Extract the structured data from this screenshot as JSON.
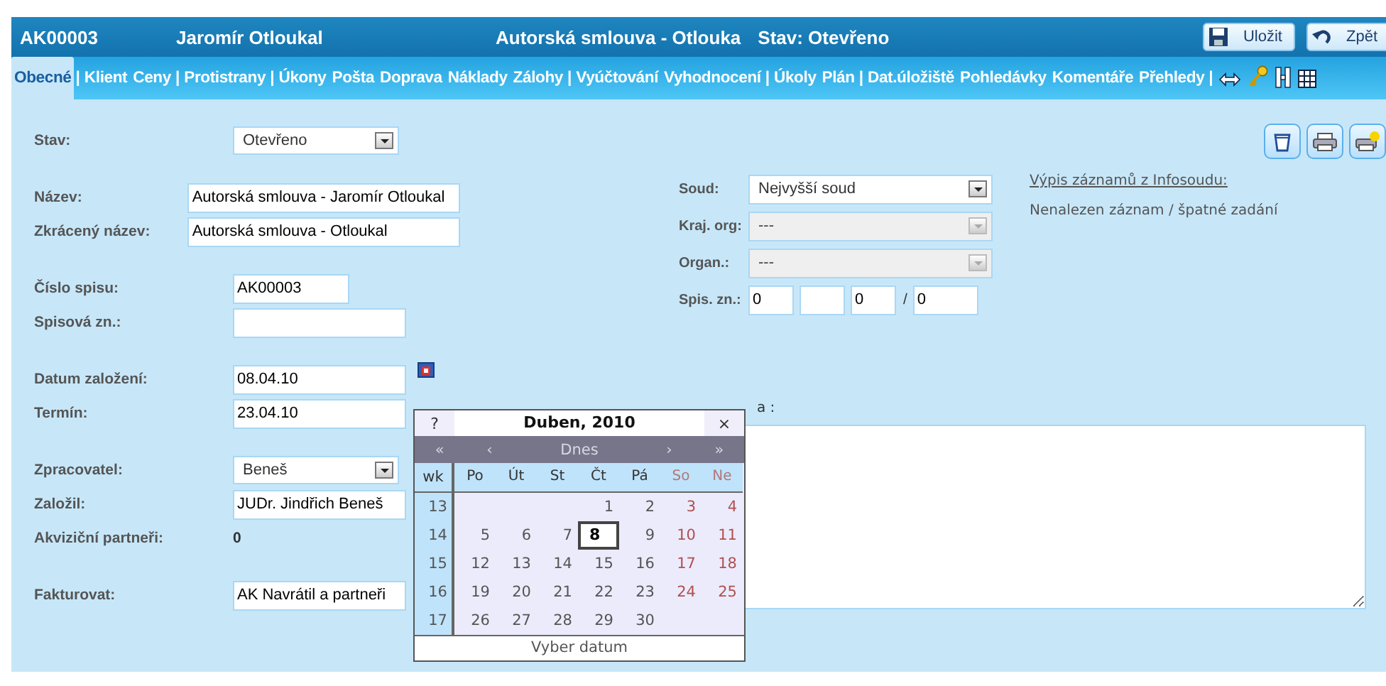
{
  "header": {
    "code": "AK00003",
    "client": "Jaromír Otloukal",
    "title": "Autorská smlouva - Otlouka",
    "status": "Stav:  Otevřeno",
    "buttons": [
      {
        "kind": "save",
        "label": "Uložit"
      },
      {
        "kind": "back",
        "label": "Zpět"
      }
    ]
  },
  "tabs": [
    {
      "kind": "tab",
      "label": "Obecné",
      "selected": true
    },
    {
      "kind": "sep",
      "label": "|"
    },
    {
      "kind": "tab",
      "label": "Klient",
      "selected": false
    },
    {
      "kind": "tab",
      "label": "Ceny",
      "selected": false
    },
    {
      "kind": "sep",
      "label": "|"
    },
    {
      "kind": "tab",
      "label": "Protistrany",
      "selected": false
    },
    {
      "kind": "sep",
      "label": "|"
    },
    {
      "kind": "tab",
      "label": "Úkony",
      "selected": false
    },
    {
      "kind": "tab",
      "label": "Pošta",
      "selected": false
    },
    {
      "kind": "tab",
      "label": "Doprava",
      "selected": false
    },
    {
      "kind": "tab",
      "label": "Náklady",
      "selected": false
    },
    {
      "kind": "tab",
      "label": "Zálohy",
      "selected": false
    },
    {
      "kind": "sep",
      "label": "|"
    },
    {
      "kind": "tab",
      "label": "Vyúčtování",
      "selected": false
    },
    {
      "kind": "tab",
      "label": "Vyhodnocení",
      "selected": false
    },
    {
      "kind": "sep",
      "label": "|"
    },
    {
      "kind": "tab",
      "label": "Úkoly",
      "selected": false
    },
    {
      "kind": "tab",
      "label": "Plán",
      "selected": false
    },
    {
      "kind": "sep",
      "label": "|"
    },
    {
      "kind": "tab",
      "label": "Dat.úložiště",
      "selected": false
    },
    {
      "kind": "tab",
      "label": "Pohledávky",
      "selected": false
    },
    {
      "kind": "tab",
      "label": "Komentáře",
      "selected": false
    },
    {
      "kind": "tab",
      "label": "Přehledy",
      "selected": false
    },
    {
      "kind": "sep",
      "label": "|"
    },
    {
      "kind": "icon"
    },
    {
      "kind": "icon"
    },
    {
      "kind": "icon"
    },
    {
      "kind": "icon"
    }
  ],
  "left_fields": [
    {
      "label": "Stav:",
      "kind": "select",
      "value": "Otevřeno"
    },
    {
      "label": "Název:",
      "kind": "input",
      "value": "Autorská smlouva - Jaromír Otloukal"
    },
    {
      "label": "Zkrácený název:",
      "kind": "input",
      "value": "Autorská smlouva - Otloukal"
    },
    {
      "label": "Číslo spisu:",
      "kind": "input",
      "value": "AK00003"
    },
    {
      "label": "Spisová zn.:",
      "kind": "input"
    },
    {
      "label": "Datum založení:",
      "kind": "date",
      "value": "08.04.10"
    },
    {
      "label": "Termín:",
      "kind": "input",
      "value": "23.04.10"
    },
    {
      "label": "Zpracovatel:",
      "kind": "select",
      "value": "Beneš"
    },
    {
      "label": "Založil:",
      "kind": "input",
      "value": "JUDr. Jindřich Beneš"
    },
    {
      "label": "Akviziční partneři:",
      "kind": "text",
      "value": "0"
    },
    {
      "label": "Fakturovat:",
      "kind": "input",
      "value": "AK Navrátil a partneři"
    }
  ],
  "court": [
    {
      "label": "Soud:",
      "value": "Nejvyšší soud",
      "disabled": false
    },
    {
      "label": "Kraj. org:",
      "value": "---",
      "disabled": true
    },
    {
      "label": "Organ.:",
      "value": "---",
      "disabled": true
    }
  ],
  "file_mark": {
    "label": "Spis. zn.:",
    "parts": [
      {
        "kind": "filled",
        "value": "0"
      },
      {
        "kind": "empty"
      },
      {
        "kind": "filled",
        "value": "0"
      }
    ],
    "separator": "/",
    "last": "0"
  },
  "infosoud": {
    "link": "Výpis záznamů z Infosoudu:",
    "message": "Nenalezen záznam / špatné zadání"
  },
  "note": {
    "label": "a :"
  },
  "calendar": {
    "help": "?",
    "title": "Duben, 2010",
    "close": "×",
    "nav": [
      "«",
      "‹",
      "Dnes",
      "›",
      "»"
    ],
    "week_header": "wk",
    "day_headers": [
      "Po",
      "Út",
      "St",
      "Čt",
      "Pá",
      "So",
      "Ne"
    ],
    "weeks": [
      {
        "wk": "13",
        "days": [
          {
            "d": "1",
            "selected": false
          },
          {
            "d": "2",
            "selected": false
          },
          {
            "d": "3",
            "selected": false
          },
          {
            "d": "4",
            "selected": false
          }
        ]
      },
      {
        "wk": "14",
        "days": [
          {
            "d": "5",
            "selected": false
          },
          {
            "d": "6",
            "selected": false
          },
          {
            "d": "7",
            "selected": false
          },
          {
            "d": "8",
            "selected": true
          },
          {
            "d": "9",
            "selected": false
          },
          {
            "d": "10",
            "selected": false
          },
          {
            "d": "11",
            "selected": false
          }
        ]
      },
      {
        "wk": "15",
        "days": [
          {
            "d": "12",
            "selected": false
          },
          {
            "d": "13",
            "selected": false
          },
          {
            "d": "14",
            "selected": false
          },
          {
            "d": "15",
            "selected": false
          },
          {
            "d": "16",
            "selected": false
          },
          {
            "d": "17",
            "selected": false
          },
          {
            "d": "18",
            "selected": false
          }
        ]
      },
      {
        "wk": "16",
        "days": [
          {
            "d": "19",
            "selected": false
          },
          {
            "d": "20",
            "selected": false
          },
          {
            "d": "21",
            "selected": false
          },
          {
            "d": "22",
            "selected": false
          },
          {
            "d": "23",
            "selected": false
          },
          {
            "d": "24",
            "selected": false
          },
          {
            "d": "25",
            "selected": false
          }
        ]
      },
      {
        "wk": "17",
        "days": [
          {
            "d": "26",
            "selected": false
          },
          {
            "d": "27",
            "selected": false
          },
          {
            "d": "28",
            "selected": false
          },
          {
            "d": "29",
            "selected": false
          },
          {
            "d": "30",
            "selected": false
          }
        ]
      }
    ],
    "footer": "Vyber datum"
  }
}
